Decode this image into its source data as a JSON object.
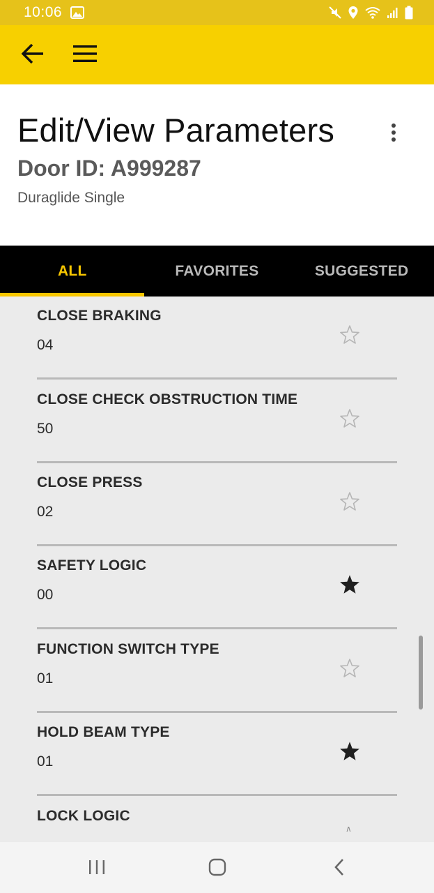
{
  "status_bar": {
    "time": "10:06"
  },
  "header": {
    "title": "Edit/View Parameters",
    "door_id": "Door ID: A999287",
    "door_model": "Duraglide Single"
  },
  "tabs": [
    {
      "label": "ALL",
      "active": true
    },
    {
      "label": "FAVORITES",
      "active": false
    },
    {
      "label": "SUGGESTED",
      "active": false
    }
  ],
  "parameters": [
    {
      "name": "CLOSE BRAKING",
      "value": "04",
      "favorite": false
    },
    {
      "name": "CLOSE CHECK OBSTRUCTION TIME",
      "value": "50",
      "favorite": false
    },
    {
      "name": "CLOSE PRESS",
      "value": "02",
      "favorite": false
    },
    {
      "name": "SAFETY LOGIC",
      "value": "00",
      "favorite": true
    },
    {
      "name": "FUNCTION SWITCH TYPE",
      "value": "01",
      "favorite": false
    },
    {
      "name": "HOLD BEAM TYPE",
      "value": "01",
      "favorite": true
    },
    {
      "name": "LOCK LOGIC",
      "value": "",
      "favorite": false
    }
  ],
  "colors": {
    "app_bar": "#f7d000",
    "status_bar": "#e6c21a",
    "tab_active": "#f7c600",
    "tab_inactive": "#b9b9b9"
  },
  "icons": {
    "back": "arrow-left-icon",
    "menu": "hamburger-menu-icon",
    "more": "vertical-dots-icon",
    "star_empty": "star-outline-icon",
    "star_filled": "star-filled-icon"
  }
}
